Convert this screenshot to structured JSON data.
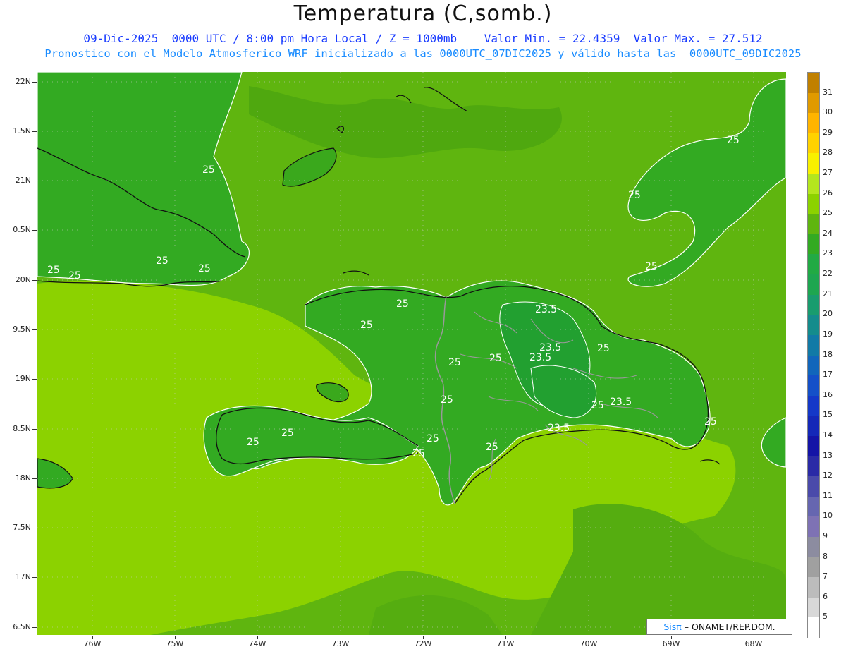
{
  "header": {
    "title": "Temperatura (C,somb.)",
    "line1": "09-Dic-2025  0000 UTC / 8:00 pm Hora Local / Z = 1000mb    Valor Min. = 22.4359  Valor Max. = 27.512",
    "line2": "Pronostico con el Modelo Atmosferico WRF inicializado a las 0000UTC_07DIC2025 y válido hasta las  0000UTC_09DIC2025"
  },
  "axes": {
    "lat_labels": [
      "22N",
      "1.5N",
      "21N",
      "0.5N",
      "20N",
      "9.5N",
      "19N",
      "8.5N",
      "18N",
      "7.5N",
      "17N",
      "6.5N"
    ],
    "lon_labels": [
      "76W",
      "75W",
      "74W",
      "73W",
      "72W",
      "71W",
      "70W",
      "69W",
      "68W"
    ]
  },
  "colorbar": {
    "labels": [
      "31",
      "30",
      "29",
      "28",
      "27",
      "26",
      "25",
      "24",
      "23",
      "22",
      "21",
      "20",
      "19",
      "18",
      "17",
      "16",
      "15",
      "14",
      "13",
      "12",
      "11",
      "10",
      "9",
      "8",
      "7",
      "6",
      "5"
    ],
    "colors": [
      "#c08000",
      "#e09a00",
      "#ffb400",
      "#ffd200",
      "#f8f000",
      "#b4e61e",
      "#8cd200",
      "#5fb50f",
      "#33aa22",
      "#22aa44",
      "#1ea650",
      "#199c6e",
      "#148c8c",
      "#117aa6",
      "#1166bb",
      "#1450c8",
      "#1438c8",
      "#1428b8",
      "#1414a6",
      "#2a2aa6",
      "#4a4aaa",
      "#6666b0",
      "#7e72b4",
      "#8c8ca0",
      "#a0a0a0",
      "#bcbcbc",
      "#d8d8d8",
      "#ffffff"
    ]
  },
  "contour_labels": [
    "25",
    "23.5"
  ],
  "credit": {
    "sis": "Sisπ",
    "rest": " – ONAMET/REP.DOM."
  },
  "colors": {
    "sea_light": "#8cd200",
    "sea_mid": "#5fb50f",
    "land_dark": "#33aa22",
    "land_darker": "#22a030",
    "coast": "#111111",
    "border": "#999999"
  }
}
